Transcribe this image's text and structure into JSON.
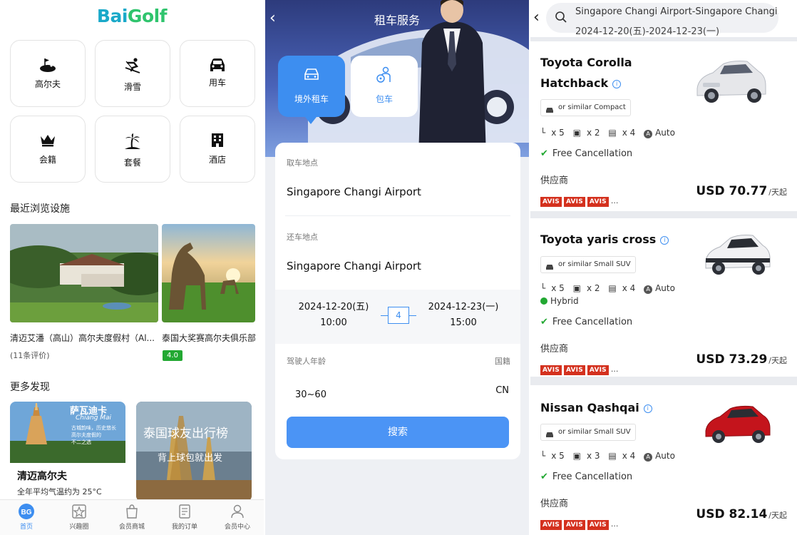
{
  "home": {
    "logo_part1": "Bai",
    "logo_part2": "Golf",
    "categories": [
      {
        "label": "高尔夫",
        "icon": "golf-icon"
      },
      {
        "label": "滑雪",
        "icon": "ski-icon"
      },
      {
        "label": "用车",
        "icon": "car-icon"
      },
      {
        "label": "会籍",
        "icon": "crown-icon"
      },
      {
        "label": "套餐",
        "icon": "beach-icon"
      },
      {
        "label": "酒店",
        "icon": "hotel-icon"
      }
    ],
    "recent_title": "最近浏览设施",
    "recent": [
      {
        "title": "清迈艾潘（高山）高尔夫度假村（Al...",
        "reviews": "(11条评价)"
      },
      {
        "title": "泰国大奖赛高尔夫俱乐部",
        "rating": "4.0"
      }
    ],
    "discover_title": "更多发现",
    "discover": [
      {
        "title": "清迈高尔夫",
        "subtitle": "全年平均气温约为 25°C",
        "banner": "萨瓦迪卡",
        "banner_sub": "Chiang Mai",
        "banner_lines": [
          "古城韵味，历史悠长",
          "高尔夫度假的",
          "不二之选"
        ]
      },
      {
        "banner": "泰国球友出行榜",
        "banner_sub": "背上球包就出发"
      }
    ],
    "nav": [
      {
        "label": "首页",
        "icon": "home-icon",
        "active": true
      },
      {
        "label": "兴趣圈",
        "icon": "interest-icon"
      },
      {
        "label": "会员商城",
        "icon": "shop-icon"
      },
      {
        "label": "我的订单",
        "icon": "orders-icon"
      },
      {
        "label": "会员中心",
        "icon": "member-icon"
      }
    ]
  },
  "rental": {
    "title": "租车服务",
    "service_tabs": [
      {
        "label": "境外租车",
        "icon": "car-front-icon",
        "active": true
      },
      {
        "label": "包车",
        "icon": "chauffeur-icon",
        "active": false
      }
    ],
    "pickup_label": "取车地点",
    "pickup_value": "Singapore Changi Airport",
    "return_label": "还车地点",
    "return_value": "Singapore Changi Airport",
    "start_date": "2024-12-20(五)",
    "start_time": "10:00",
    "days": "4",
    "end_date": "2024-12-23(一)",
    "end_time": "15:00",
    "age_label": "驾驶人年龄",
    "age_value": "30~60",
    "nationality_label": "国籍",
    "nationality_value": "CN",
    "search_label": "搜索"
  },
  "results": {
    "route": "Singapore Changi Airport-Singapore Changi...",
    "dates": "2024-12-20(五)-2024-12-23(一)",
    "cars": [
      {
        "name_line1": "Toyota Corolla",
        "name_line2": "Hatchback",
        "similar": "or similar  Compact",
        "seats": "x 5",
        "bags": "x 2",
        "doors": "x 4",
        "trans": "Auto",
        "cancel": "Free Cancellation",
        "supplier": "供应商",
        "price": "USD 70.77",
        "unit": "/天起",
        "color": "#e8e8ea"
      },
      {
        "name_line1": "Toyota yaris cross",
        "similar": "or similar  Small SUV",
        "seats": "x 5",
        "bags": "x 2",
        "doors": "x 4",
        "trans": "Auto",
        "hybrid": "Hybrid",
        "cancel": "Free Cancellation",
        "supplier": "供应商",
        "price": "USD 73.29",
        "unit": "/天起",
        "color": "#f0f0f2"
      },
      {
        "name_line1": "Nissan Qashqai",
        "similar": "or similar  Small SUV",
        "seats": "x 5",
        "bags": "x 3",
        "doors": "x 4",
        "trans": "Auto",
        "cancel": "Free Cancellation",
        "supplier": "供应商",
        "price": "USD 82.14",
        "unit": "/天起",
        "color": "#c4141c"
      }
    ],
    "avis": [
      "AVIS",
      "AVIS",
      "AVIS",
      "..."
    ]
  },
  "colors": {
    "accent_blue": "#4b94f5",
    "avis_red": "#d4311e",
    "green": "#22a832"
  }
}
